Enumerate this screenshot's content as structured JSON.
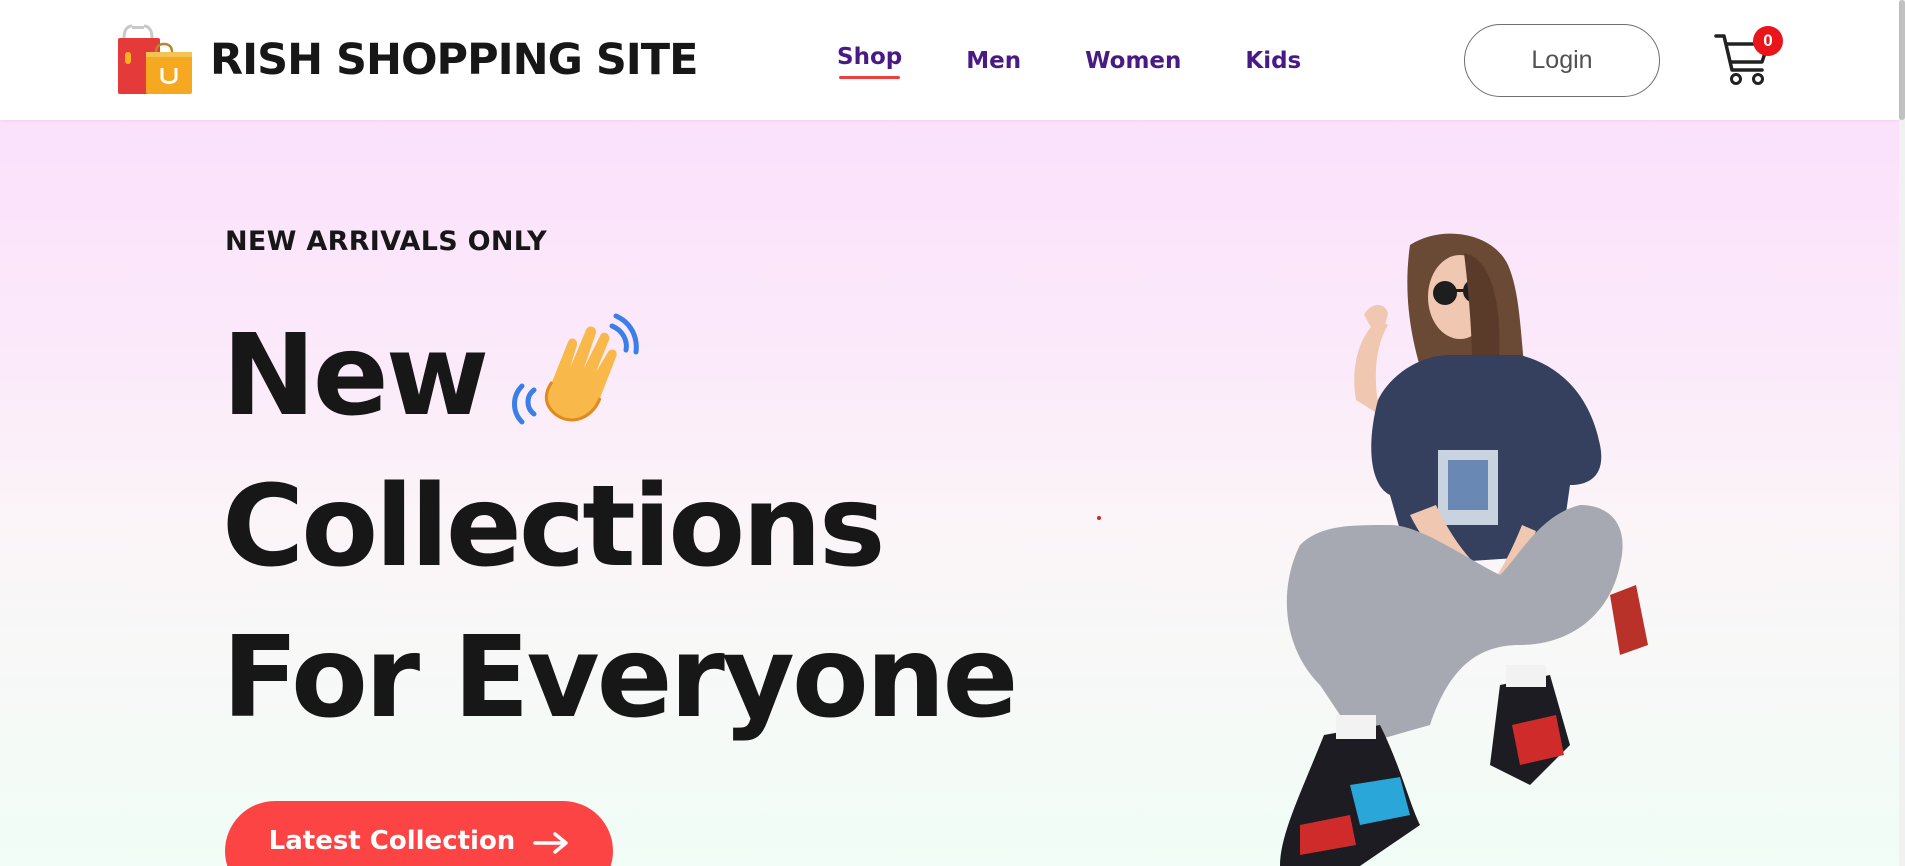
{
  "brand": {
    "name": "RISH SHOPPING SITE",
    "logo_icon": "shopping-bags-icon"
  },
  "nav": {
    "items": [
      {
        "label": "Shop",
        "active": true
      },
      {
        "label": "Men",
        "active": false
      },
      {
        "label": "Women",
        "active": false
      },
      {
        "label": "Kids",
        "active": false
      }
    ]
  },
  "header": {
    "login_label": "Login",
    "cart_icon": "cart-icon",
    "cart_count": "0"
  },
  "hero": {
    "eyebrow": "NEW ARRIVALS ONLY",
    "headline": [
      "New",
      "Collections",
      "For Everyone"
    ],
    "wave_icon": "waving-hand-icon",
    "cta_label": "Latest Collection",
    "cta_icon": "arrow-right-icon",
    "hero_image": "model-photo"
  },
  "colors": {
    "nav_text": "#4a1a84",
    "accent": "#fc4444",
    "badge": "#e9151a",
    "heading": "#171717"
  }
}
